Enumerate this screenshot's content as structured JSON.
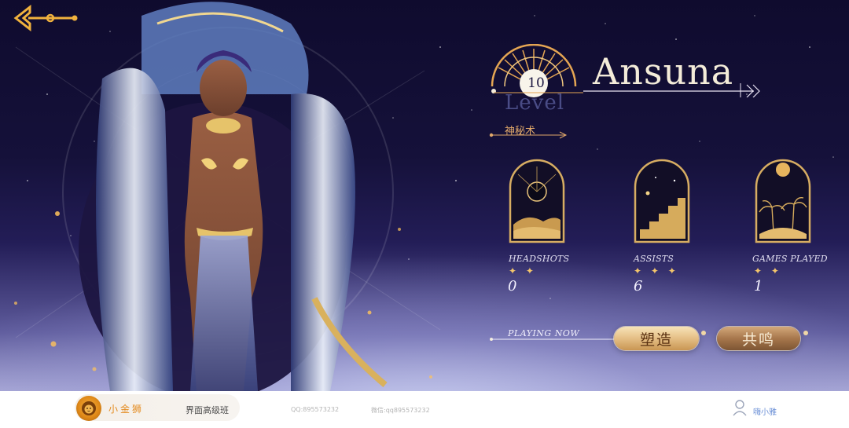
{
  "hero": {
    "name": "Ansuna",
    "level": "10",
    "level_label": "Level",
    "subtitle": "神秘术"
  },
  "stats": [
    {
      "label": "HEADSHOTS",
      "stars": "✦ ✦",
      "value": "0",
      "icon": "sun-over-dunes-icon"
    },
    {
      "label": "ASSISTS",
      "stars": "✦ ✦ ✦",
      "value": "6",
      "icon": "staircase-icon"
    },
    {
      "label": "GAMES PLAYED",
      "stars": "✦ ✦",
      "value": "1",
      "icon": "palm-oasis-icon"
    }
  ],
  "playing": {
    "label": "PLAYING NOW"
  },
  "actions": {
    "shape_label": "塑造",
    "resonate_label": "共鸣"
  },
  "footer": {
    "brand": "小金狮",
    "course": "界面高级班",
    "qq": "QQ:895573232",
    "wechat": "微信:qq895573232",
    "user": "嗨小雅"
  },
  "colors": {
    "accent_gold": "#f3c56b",
    "name_cream": "#f4ecd9",
    "subtitle_orange": "#e0a86a",
    "brand_orange": "#e48b1f"
  }
}
